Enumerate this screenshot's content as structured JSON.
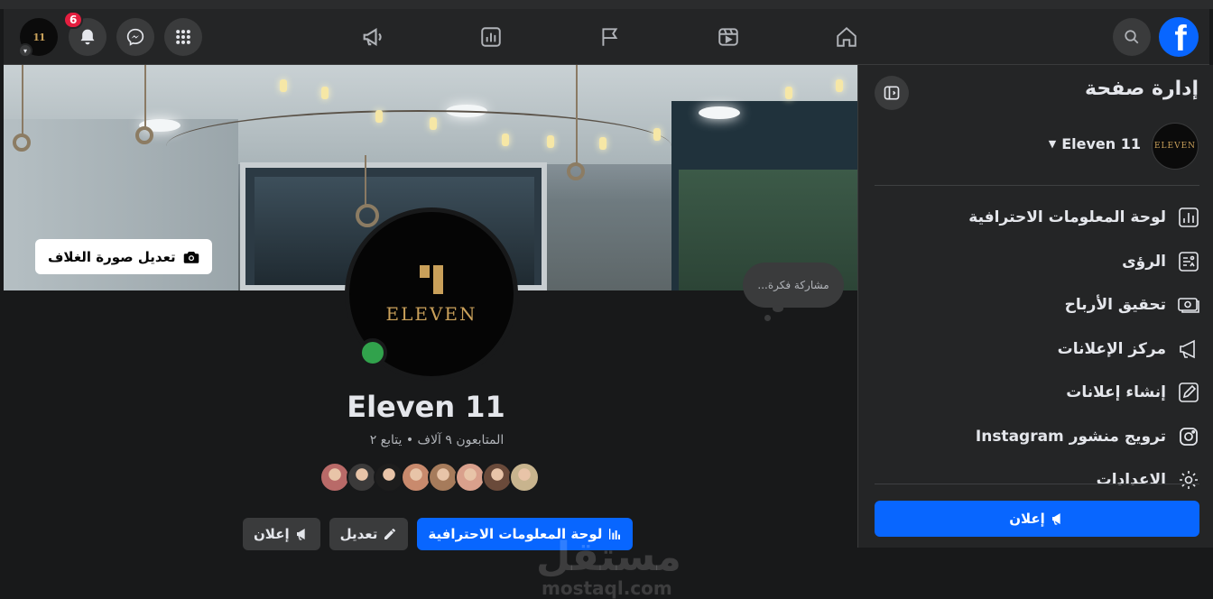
{
  "topbar": {
    "notification_count": "6",
    "avatar_logo": "11"
  },
  "cover": {
    "edit_cover_label": "تعديل صورة الغلاف",
    "thought_placeholder": "مشاركة فكرة..."
  },
  "profile": {
    "logo_text": "ELEVEN",
    "name": "Eleven 11",
    "followers_line": "المتابعون ٩ آلاف • يتابع ٢",
    "facepile_colors": [
      "#b96a68",
      "#3b3a3a",
      "#1d1d1d",
      "#c98a6d",
      "#a67b5b",
      "#d9a08c",
      "#6a4a3a",
      "#c8b48e"
    ]
  },
  "actions": {
    "dashboard_label": "لوحة المعلومات الاحترافية",
    "edit_label": "تعديل",
    "ad_label": "إعلان"
  },
  "sidebar": {
    "title": "إدارة صفحة",
    "page_switch_label": "Eleven 11",
    "avatar_text": "ELEVEN",
    "items": [
      {
        "label": "لوحة المعلومات الاحترافية",
        "icon": "dashboard-icon"
      },
      {
        "label": "الرؤى",
        "icon": "insights-icon"
      },
      {
        "label": "تحقيق الأرباح",
        "icon": "monetization-icon"
      },
      {
        "label": "مركز الإعلانات",
        "icon": "megaphone-icon"
      },
      {
        "label": "إنشاء إعلانات",
        "icon": "pencil-icon"
      },
      {
        "label": "ترويج منشور Instagram",
        "icon": "instagram-icon"
      },
      {
        "label": "الاعدادات",
        "icon": "gear-icon"
      }
    ],
    "ad_button_label": "إعلان"
  },
  "watermark": {
    "arabic": "مستقل",
    "latin": "mostaql.com"
  },
  "colors": {
    "accent": "#0866ff",
    "badge": "#e41e3f",
    "online": "#31a24c",
    "gold": "#c9a05a"
  }
}
